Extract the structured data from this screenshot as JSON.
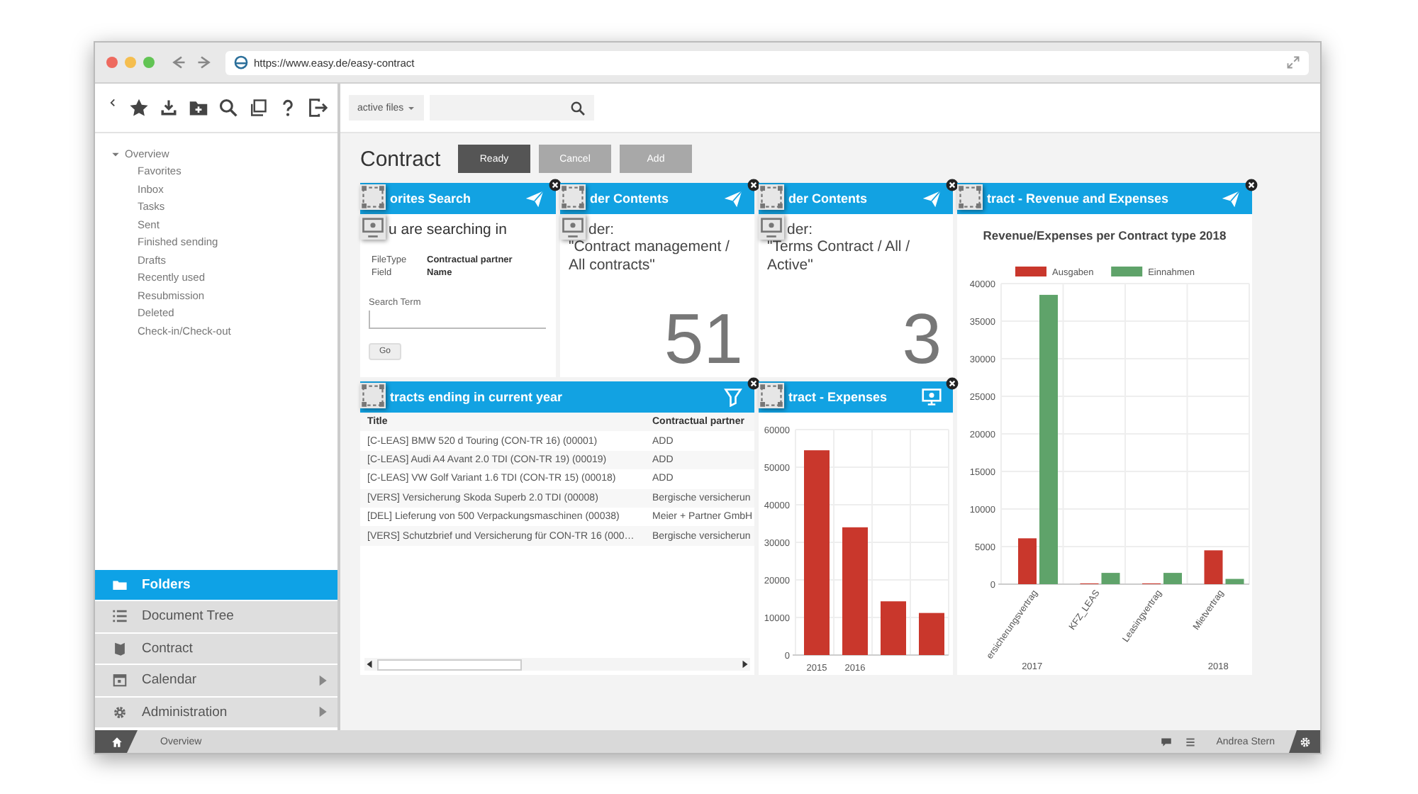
{
  "browser": {
    "url": "https://www.easy.de/easy-contract"
  },
  "sidebar": {
    "tree": [
      {
        "label": "Overview",
        "expanded": true,
        "children": [
          {
            "label": "Favorites"
          },
          {
            "label": "Inbox"
          },
          {
            "label": "Tasks"
          },
          {
            "label": "Sent"
          },
          {
            "label": "Finished sending"
          },
          {
            "label": "Drafts"
          },
          {
            "label": "Recently used"
          },
          {
            "label": "Resubmission"
          },
          {
            "label": "Deleted"
          },
          {
            "label": "Check-in/Check-out"
          }
        ]
      }
    ],
    "nav": [
      {
        "label": "Folders",
        "selected": true,
        "has_submenu": false
      },
      {
        "label": "Document Tree",
        "selected": false,
        "has_submenu": false
      },
      {
        "label": "Contract",
        "selected": false,
        "has_submenu": false
      },
      {
        "label": "Calendar",
        "selected": false,
        "has_submenu": true
      },
      {
        "label": "Administration",
        "selected": false,
        "has_submenu": true
      }
    ]
  },
  "toolbar": {
    "filter": "active files"
  },
  "page": {
    "title": "Contract",
    "buttons": [
      {
        "label": "Ready",
        "kind": "primary"
      },
      {
        "label": "Cancel",
        "kind": "secondary"
      },
      {
        "label": "Add",
        "kind": "secondary"
      }
    ]
  },
  "widgets": [
    {
      "kind": "search",
      "title": "orites Search",
      "heading": "u are searching in",
      "fields": [
        {
          "label": "FileType",
          "value": "Contractual partner"
        },
        {
          "label": "Field",
          "value": "Name"
        }
      ],
      "input_label": "Search Term",
      "button": "Go"
    },
    {
      "kind": "count",
      "title": "der Contents",
      "folder_label": "der:",
      "folder": "\"Contract management / All contracts\"",
      "count": "51"
    },
    {
      "kind": "count",
      "title": "der Contents",
      "folder_label": "der:",
      "folder": "\"Terms Contract / All / Active\"",
      "count": "3"
    },
    {
      "kind": "chart",
      "title": "tract - Revenue and Expenses",
      "chart_data": {
        "type": "bar",
        "title": "Revenue/Expenses per Contract type 2018",
        "categories": [
          "ersicherungsvertrag",
          "KFZ_LEAS",
          "Leasingvertrag",
          "Mietvertrag"
        ],
        "series": [
          {
            "name": "Ausgaben",
            "color": "#c9372c",
            "values": [
              6100,
              100,
              100,
              4500
            ]
          },
          {
            "name": "Einnahmen",
            "color": "#5fa36a",
            "values": [
              38500,
              1500,
              1500,
              700
            ]
          }
        ],
        "ylim": [
          0,
          40000
        ],
        "yticks": [
          0,
          5000,
          10000,
          15000,
          20000,
          25000,
          30000,
          35000,
          40000
        ],
        "grid": true,
        "legend": "top",
        "annotations": [
          "2017",
          "2018"
        ]
      }
    },
    {
      "kind": "table",
      "title": "tracts ending in current year",
      "columns": [
        "Title",
        "Contractual partner"
      ],
      "rows": [
        [
          "[C-LEAS] BMW 520 d Touring (CON-TR 16) (00001)",
          "ADD"
        ],
        [
          "[C-LEAS] Audi A4 Avant 2.0 TDI (CON-TR 19) (00019)",
          "ADD"
        ],
        [
          "[C-LEAS] VW Golf Variant 1.6 TDI (CON-TR 15) (00018)",
          "ADD"
        ],
        [
          "[VERS] Versicherung Skoda Superb 2.0 TDI (00008)",
          "Bergische versicherun"
        ],
        [
          "[DEL] Lieferung von 500 Verpackungsmaschinen (00038)",
          "Meier + Partner GmbH"
        ],
        [
          "[VERS] Schutzbrief und Versicherung für CON-TR 16 (000…",
          "Bergische versicherun"
        ]
      ]
    },
    {
      "kind": "chart",
      "title": "tract - Expenses",
      "chart_data": {
        "type": "bar",
        "categories": [
          "2015",
          "2016",
          null,
          null
        ],
        "values": [
          54500,
          34000,
          14300,
          11200
        ],
        "color": "#c9372c",
        "grid": true,
        "ylim": [
          0,
          60000
        ],
        "yticks": [
          0,
          10000,
          20000,
          30000,
          40000,
          50000,
          60000
        ]
      }
    }
  ],
  "status_bar": {
    "location": "Overview",
    "user": "Andrea Stern"
  }
}
